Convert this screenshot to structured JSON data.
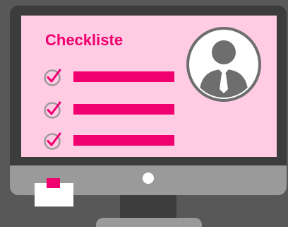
{
  "screen": {
    "title": "Checkliste"
  },
  "checklist": {
    "items": [
      {
        "icon": "checkmark-circle-icon",
        "checked": true
      },
      {
        "icon": "checkmark-circle-icon",
        "checked": true
      },
      {
        "icon": "checkmark-circle-icon",
        "checked": true
      }
    ]
  },
  "avatar": {
    "icon": "person-with-tie-icon"
  },
  "colors": {
    "background": "#585858",
    "monitor_frame": "#3c3c3c",
    "monitor_chin": "#9a9a9a",
    "screen": "#ffcce4",
    "accent": "#f0006e",
    "check_circle": "#9a9a9a"
  }
}
